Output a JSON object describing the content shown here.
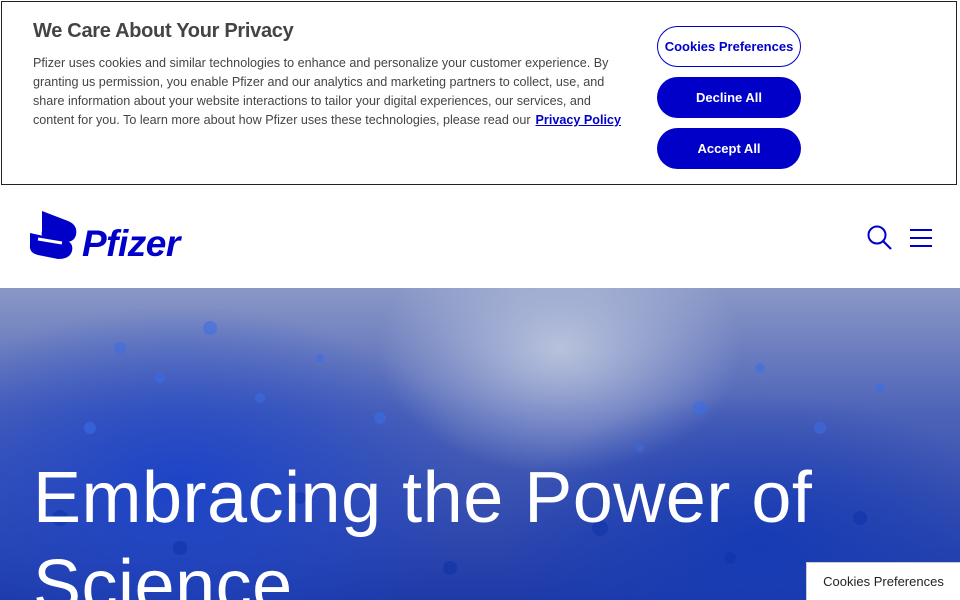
{
  "cookie_banner": {
    "title": "We Care About Your Privacy",
    "body": "Pfizer uses cookies and similar technologies to enhance and personalize your customer experience. By granting us permission, you enable Pfizer and our analytics and marketing partners to collect, use, and share information about your website interactions to tailor your digital experiences, our services, and content for you. To learn more about how Pfizer uses these technologies, please read our",
    "policy_link": "Privacy Policy",
    "preferences_label": "Cookies Preferences",
    "decline_label": "Decline All",
    "accept_label": "Accept All"
  },
  "header": {
    "logo_text": "Pfizer",
    "search_icon": "search-icon",
    "menu_icon": "hamburger-menu-icon"
  },
  "hero": {
    "title": "Embracing the Power of Science"
  },
  "floating": {
    "preferences_label": "Cookies Preferences"
  },
  "colors": {
    "brand": "#0000c9"
  }
}
